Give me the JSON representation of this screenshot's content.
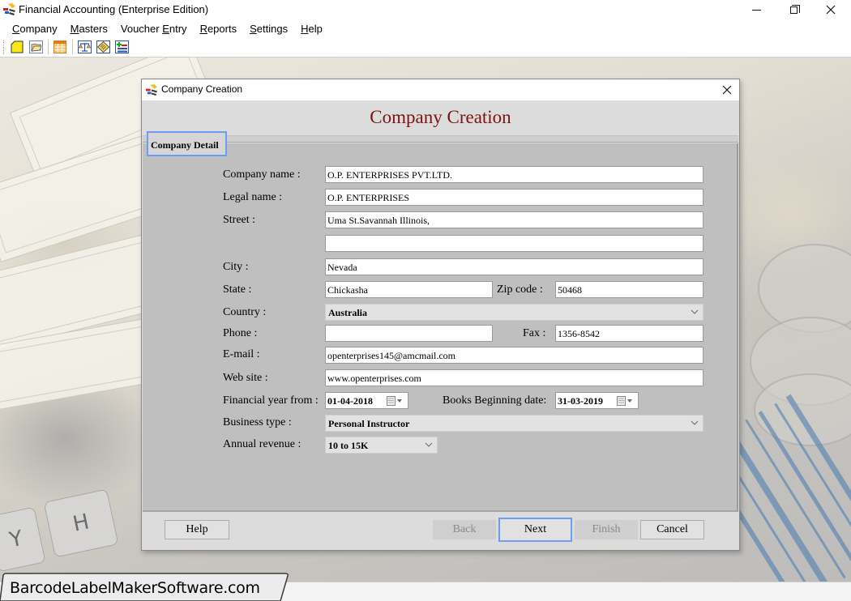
{
  "app": {
    "title": "Financial Accounting (Enterprise Edition)",
    "window_controls": {
      "minimize": "minimize",
      "maximize": "restore",
      "close": "close"
    }
  },
  "menu": [
    {
      "label": "Company",
      "mnemonic": "C",
      "rest": "ompany"
    },
    {
      "label": "Masters",
      "mnemonic": "M",
      "rest": "asters"
    },
    {
      "label": "Voucher Entry",
      "pre": "Voucher ",
      "mnemonic": "E",
      "rest": "ntry"
    },
    {
      "label": "Reports",
      "mnemonic": "R",
      "rest": "eports"
    },
    {
      "label": "Settings",
      "mnemonic": "S",
      "rest": "ettings"
    },
    {
      "label": "Help",
      "mnemonic": "H",
      "rest": "elp"
    }
  ],
  "toolbar": {
    "icons": [
      "new-company-icon",
      "open-company-icon",
      "table-icon",
      "balance-scale-icon",
      "ledger-icon",
      "add-list-icon"
    ]
  },
  "dialog": {
    "title": "Company Creation",
    "heading": "Company Creation",
    "tab": "Company Detail",
    "labels": {
      "company_name": "Company name :",
      "legal_name": "Legal name :",
      "street": "Street :",
      "city": "City :",
      "state": "State :",
      "zip": "Zip code :",
      "country": "Country :",
      "phone": "Phone :",
      "fax": "Fax :",
      "email": "E-mail :",
      "website": "Web site :",
      "fy_from": "Financial year from :",
      "books_beginning": "Books Beginning date:",
      "business_type": "Business type :",
      "annual_revenue": "Annual revenue :"
    },
    "values": {
      "company_name": "O.P. ENTERPRISES PVT.LTD.",
      "legal_name": "O.P. ENTERPRISES",
      "street1": "Uma St.Savannah Illinois,",
      "street2": "",
      "city": "Nevada",
      "state": "Chickasha",
      "zip": "50468",
      "country": "Australia",
      "phone": "",
      "fax": "1356-8542",
      "email": "openterprises145@amcmail.com",
      "website": "www.openterprises.com",
      "fy_from": "01-04-2018",
      "books_beginning": "31-03-2019",
      "business_type": "Personal Instructor",
      "annual_revenue": "10 to 15K"
    },
    "buttons": {
      "help": "Help",
      "back": "Back",
      "next": "Next",
      "finish": "Finish",
      "cancel": "Cancel"
    },
    "heading_color": "#7a1414",
    "focus_color": "#6d9cf0"
  },
  "watermark": "BarcodeLabelMakerSoftware.com"
}
